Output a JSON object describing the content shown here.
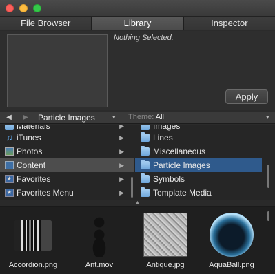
{
  "tabs": [
    "File Browser",
    "Library",
    "Inspector"
  ],
  "inspector": {
    "status": "Nothing Selected.",
    "apply_label": "Apply"
  },
  "toolbar": {
    "back": "◀",
    "forward": "▶",
    "location": "Particle Images",
    "theme_label": "Theme:",
    "theme_value": "All"
  },
  "sources": [
    {
      "label": "Materials",
      "icon": "folder-icon"
    },
    {
      "label": "iTunes",
      "icon": "music-note-icon"
    },
    {
      "label": "Photos",
      "icon": "photos-icon"
    },
    {
      "label": "Content",
      "icon": "content-icon"
    },
    {
      "label": "Favorites",
      "icon": "favorites-icon"
    },
    {
      "label": "Favorites Menu",
      "icon": "favorites-menu-icon"
    }
  ],
  "folders": [
    {
      "label": "Images"
    },
    {
      "label": "Lines"
    },
    {
      "label": "Miscellaneous"
    },
    {
      "label": "Particle Images"
    },
    {
      "label": "Symbols"
    },
    {
      "label": "Template Media"
    }
  ],
  "items": [
    {
      "label": "Accordion.png"
    },
    {
      "label": "Ant.mov"
    },
    {
      "label": "Antique.jpg"
    },
    {
      "label": "AquaBall.png"
    }
  ],
  "colors": {
    "selection_blue": "#2f5a8c",
    "selection_gray": "#4d4d4d",
    "folder_blue": "#8cbde8"
  }
}
